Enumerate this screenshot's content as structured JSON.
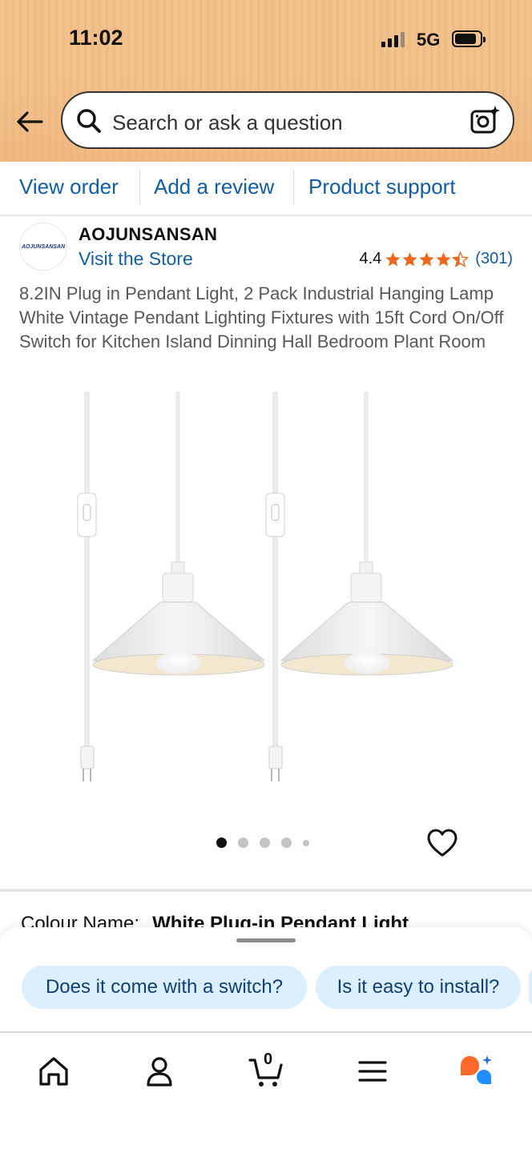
{
  "status_bar": {
    "time": "11:02",
    "network": "5G"
  },
  "search": {
    "placeholder": "Search or ask a question"
  },
  "order_links": [
    "View order",
    "Add a review",
    "Product support"
  ],
  "brand": {
    "logo_text": "AOJUNSANSAN",
    "name": "AOJUNSANSAN",
    "visit_store": "Visit the Store"
  },
  "rating": {
    "value": "4.4",
    "stars": 4.4,
    "count": "(301)"
  },
  "product": {
    "title": "8.2IN Plug in Pendant Light, 2 Pack Industrial Hanging Lamp White Vintage Pendant Lighting Fixtures with 15ft Cord On/Off Switch for Kitchen Island Dinning Hall Bedroom Plant Room",
    "image_count": 5,
    "active_image": 1
  },
  "colour": {
    "label": "Colour Name:",
    "value": "White Plug-in Pendant Light"
  },
  "suggestions": [
    "Does it come with a switch?",
    "Is it easy to install?"
  ],
  "cart": {
    "count": "0"
  },
  "tabs": [
    "home-icon",
    "account-icon",
    "cart-icon",
    "menu-icon",
    "rufus-assistant-icon"
  ],
  "colors": {
    "header": "#f2c18c",
    "link": "#0f5ea8",
    "star": "#f0661a",
    "chip": "#dcefff"
  }
}
